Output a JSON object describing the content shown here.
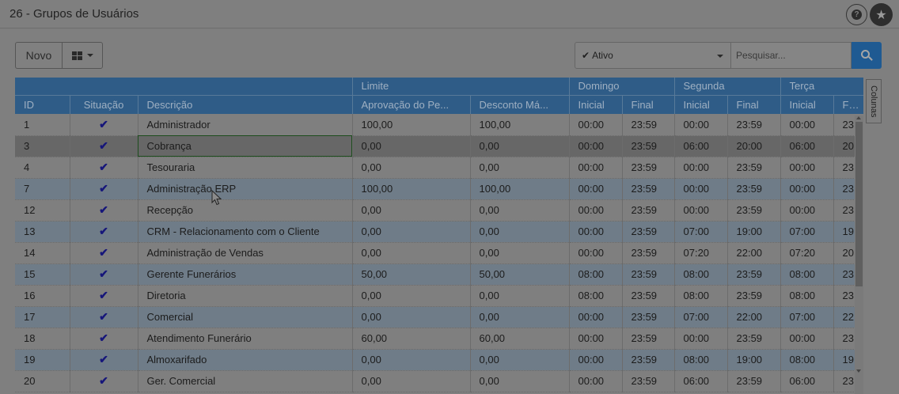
{
  "header": {
    "title": "26 - Grupos de Usuários",
    "help_icon": "question-circle-icon",
    "help_glyph": "?",
    "favorite_icon": "star-icon",
    "favorite_glyph": "★"
  },
  "toolbar": {
    "new_label": "Novo",
    "view_icon": "grid-view-icon",
    "status_check_glyph": "✔",
    "status_value": "Ativo",
    "search_placeholder": "Pesquisar...",
    "search_icon": "search-icon"
  },
  "side_tab": {
    "label": "Colunas"
  },
  "table": {
    "group_headers": {
      "limite": "Limite",
      "domingo": "Domingo",
      "segunda": "Segunda",
      "terca": "Terça"
    },
    "headers": {
      "id": "ID",
      "situacao": "Situação",
      "descricao": "Descrição",
      "aprovacao": "Aprovação do Pe...",
      "desconto": "Desconto Má...",
      "dom_inicial": "Inicial",
      "dom_final": "Final",
      "seg_inicial": "Inicial",
      "seg_final": "Final",
      "ter_inicial": "Inicial",
      "ter_final": "Final"
    },
    "check_glyph": "✔",
    "rows": [
      {
        "id": "1",
        "active": true,
        "desc": "Administrador",
        "aprov": "100,00",
        "desc_max": "100,00",
        "dom_i": "00:00",
        "dom_f": "23:59",
        "seg_i": "00:00",
        "seg_f": "23:59",
        "ter_i": "00:00",
        "ter_f": "23"
      },
      {
        "id": "3",
        "active": true,
        "desc": "Cobrança",
        "aprov": "0,00",
        "desc_max": "0,00",
        "dom_i": "00:00",
        "dom_f": "23:59",
        "seg_i": "06:00",
        "seg_f": "20:00",
        "ter_i": "06:00",
        "ter_f": "20",
        "selected": true
      },
      {
        "id": "4",
        "active": true,
        "desc": "Tesouraria",
        "aprov": "0,00",
        "desc_max": "0,00",
        "dom_i": "00:00",
        "dom_f": "23:59",
        "seg_i": "00:00",
        "seg_f": "23:59",
        "ter_i": "00:00",
        "ter_f": "23"
      },
      {
        "id": "7",
        "active": true,
        "desc": "Administração ERP",
        "aprov": "100,00",
        "desc_max": "100,00",
        "dom_i": "00:00",
        "dom_f": "23:59",
        "seg_i": "00:00",
        "seg_f": "23:59",
        "ter_i": "00:00",
        "ter_f": "23"
      },
      {
        "id": "12",
        "active": true,
        "desc": "Recepção",
        "aprov": "0,00",
        "desc_max": "0,00",
        "dom_i": "00:00",
        "dom_f": "23:59",
        "seg_i": "00:00",
        "seg_f": "23:59",
        "ter_i": "00:00",
        "ter_f": "23"
      },
      {
        "id": "13",
        "active": true,
        "desc": "CRM - Relacionamento com o Cliente",
        "aprov": "0,00",
        "desc_max": "0,00",
        "dom_i": "00:00",
        "dom_f": "23:59",
        "seg_i": "07:00",
        "seg_f": "19:00",
        "ter_i": "07:00",
        "ter_f": "19"
      },
      {
        "id": "14",
        "active": true,
        "desc": "Administração de Vendas",
        "aprov": "0,00",
        "desc_max": "0,00",
        "dom_i": "00:00",
        "dom_f": "23:59",
        "seg_i": "07:20",
        "seg_f": "22:00",
        "ter_i": "07:20",
        "ter_f": "20"
      },
      {
        "id": "15",
        "active": true,
        "desc": "Gerente Funerários",
        "aprov": "50,00",
        "desc_max": "50,00",
        "dom_i": "08:00",
        "dom_f": "23:59",
        "seg_i": "08:00",
        "seg_f": "23:59",
        "ter_i": "08:00",
        "ter_f": "23"
      },
      {
        "id": "16",
        "active": true,
        "desc": "Diretoria",
        "aprov": "0,00",
        "desc_max": "0,00",
        "dom_i": "08:00",
        "dom_f": "23:59",
        "seg_i": "08:00",
        "seg_f": "23:59",
        "ter_i": "08:00",
        "ter_f": "23"
      },
      {
        "id": "17",
        "active": true,
        "desc": "Comercial",
        "aprov": "0,00",
        "desc_max": "0,00",
        "dom_i": "00:00",
        "dom_f": "23:59",
        "seg_i": "07:00",
        "seg_f": "22:00",
        "ter_i": "07:00",
        "ter_f": "22"
      },
      {
        "id": "18",
        "active": true,
        "desc": "Atendimento Funerário",
        "aprov": "60,00",
        "desc_max": "60,00",
        "dom_i": "00:00",
        "dom_f": "23:59",
        "seg_i": "00:00",
        "seg_f": "23:59",
        "ter_i": "00:00",
        "ter_f": "23"
      },
      {
        "id": "19",
        "active": true,
        "desc": "Almoxarifado",
        "aprov": "0,00",
        "desc_max": "0,00",
        "dom_i": "00:00",
        "dom_f": "23:59",
        "seg_i": "08:00",
        "seg_f": "19:00",
        "ter_i": "08:00",
        "ter_f": "19"
      },
      {
        "id": "20",
        "active": true,
        "desc": "Ger. Comercial",
        "aprov": "0,00",
        "desc_max": "0,00",
        "dom_i": "00:00",
        "dom_f": "23:59",
        "seg_i": "06:00",
        "seg_f": "23:59",
        "ter_i": "06:00",
        "ter_f": "23"
      }
    ]
  }
}
